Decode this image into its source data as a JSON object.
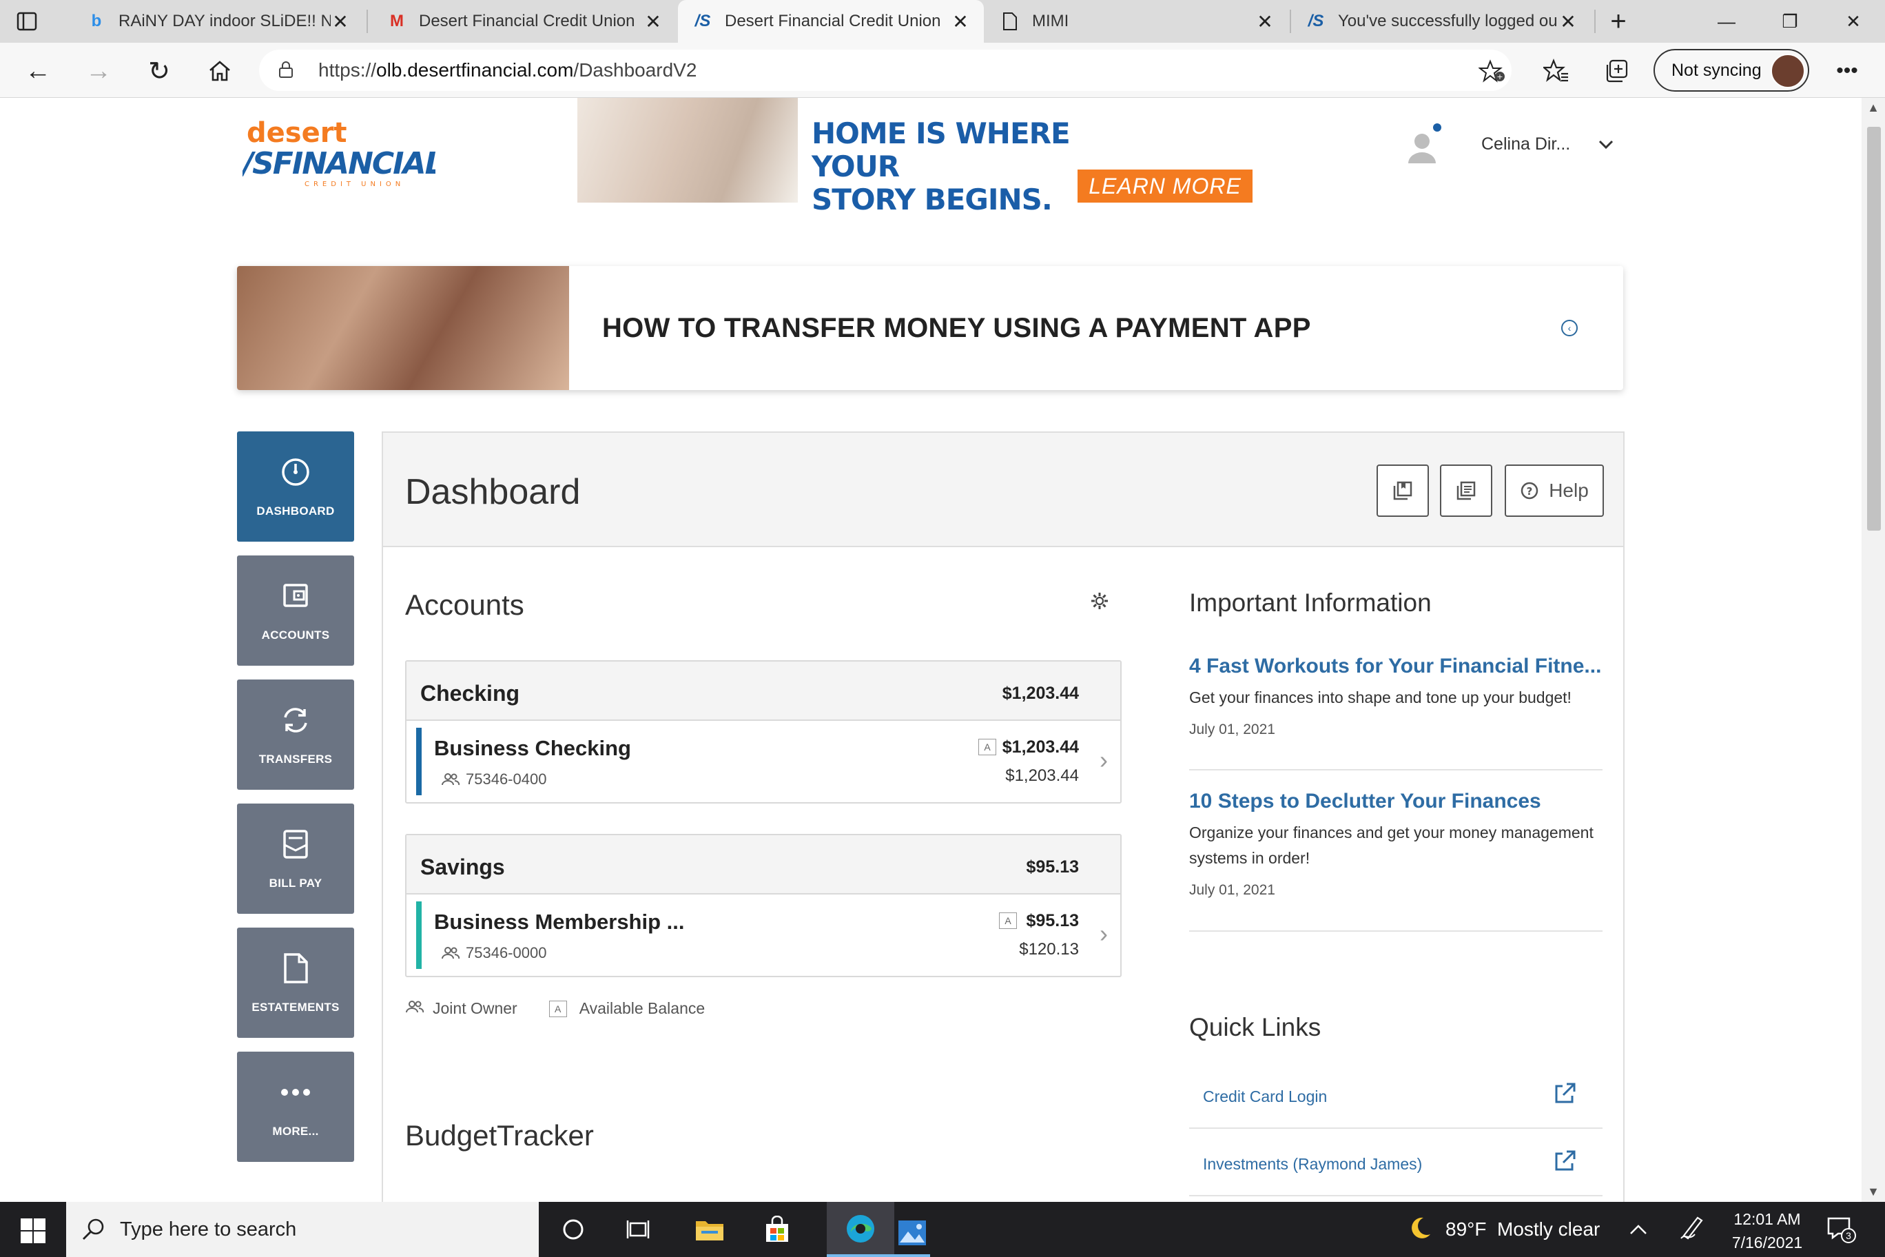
{
  "browser": {
    "tabs": [
      {
        "title": "RAiNY DAY indoor SLiDE!! Na",
        "icon": "bing-icon"
      },
      {
        "title": "Desert Financial Credit Union",
        "icon": "gmail-icon"
      },
      {
        "title": "Desert Financial Credit Union",
        "icon": "desert-financial-icon",
        "active": true
      },
      {
        "title": "MIMI",
        "icon": "document-icon"
      },
      {
        "title": "You've successfully logged ou",
        "icon": "desert-financial-icon"
      }
    ],
    "url_prefix": "https://",
    "url_host": "olb.desertfinancial.com",
    "url_path": "/DashboardV2",
    "sync_label": "Not syncing"
  },
  "header": {
    "ad_headline_line1": "HOME IS WHERE YOUR",
    "ad_headline_line2": "STORY BEGINS.",
    "ad_cta": "LEARN MORE",
    "user_name": "Celina Dir..."
  },
  "promo": {
    "title": "HOW TO TRANSFER MONEY USING A PAYMENT APP"
  },
  "sidebar": {
    "items": [
      {
        "label": "DASHBOARD",
        "icon": "gauge-icon",
        "active": true
      },
      {
        "label": "ACCOUNTS",
        "icon": "wallet-icon"
      },
      {
        "label": "TRANSFERS",
        "icon": "transfer-icon"
      },
      {
        "label": "BILL PAY",
        "icon": "bill-icon"
      },
      {
        "label": "ESTATEMENTS",
        "icon": "document-icon"
      },
      {
        "label": "MORE...",
        "icon": "more-icon"
      }
    ]
  },
  "dashboard": {
    "title": "Dashboard",
    "help_label": "Help",
    "accounts_title": "Accounts",
    "groups": [
      {
        "name": "Checking",
        "total": "$1,203.44",
        "accounts": [
          {
            "name": "Business Checking",
            "number": "75346-0400",
            "available": "$1,203.44",
            "current": "$1,203.44",
            "badge": "A",
            "color": "#1b6aa5"
          }
        ]
      },
      {
        "name": "Savings",
        "total": "$95.13",
        "accounts": [
          {
            "name": "Business Membership ...",
            "number": "75346-0000",
            "available": "$95.13",
            "current": "$120.13",
            "badge": "A",
            "color": "#22b3a6"
          }
        ]
      }
    ],
    "legend": {
      "joint_owner": "Joint Owner",
      "badge": "A",
      "available_balance": "Available Balance"
    },
    "budget_title": "BudgetTracker",
    "info_title": "Important Information",
    "news": [
      {
        "headline": "4 Fast Workouts for Your Financial Fitne...",
        "body": "Get your finances into shape and tone up your budget!",
        "date": "July 01, 2021"
      },
      {
        "headline": "10 Steps to Declutter Your Finances",
        "body": "Organize your finances and get your money management systems in order!",
        "date": "July 01, 2021"
      }
    ],
    "quick_links_title": "Quick Links",
    "quick_links": [
      {
        "label": "Credit Card Login"
      },
      {
        "label": "Investments (Raymond James)"
      }
    ]
  },
  "taskbar": {
    "search_placeholder": "Type here to search",
    "weather": "89°F  Mostly clear",
    "time": "12:01 AM",
    "date": "7/16/2021",
    "notification_count": "3"
  },
  "colors": {
    "brand_blue": "#2b6592",
    "nav_gray": "#6b7483",
    "link_blue": "#2e6ca4",
    "cta_orange": "#f47b20"
  }
}
